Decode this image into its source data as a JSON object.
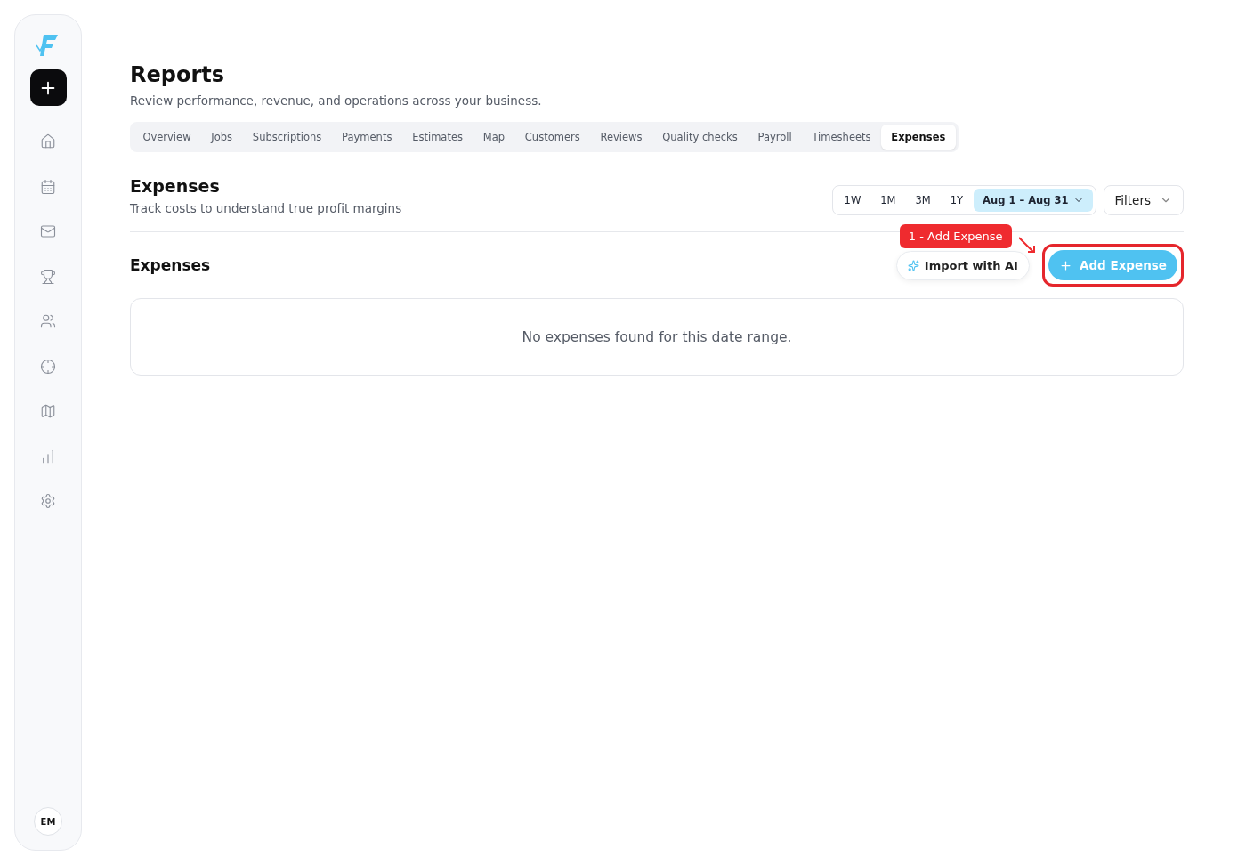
{
  "sidebar": {
    "avatar": "EM",
    "items": [
      {
        "kind": "home",
        "selected": false
      },
      {
        "kind": "calendar",
        "selected": false
      },
      {
        "kind": "mail",
        "selected": false
      },
      {
        "kind": "trophy",
        "selected": false
      },
      {
        "kind": "users",
        "selected": false
      },
      {
        "kind": "target",
        "selected": false
      },
      {
        "kind": "map",
        "selected": false
      },
      {
        "kind": "chart",
        "selected": false
      },
      {
        "kind": "settings",
        "selected": false
      }
    ]
  },
  "page": {
    "title": "Reports",
    "subtitle": "Review performance, revenue, and operations across your business."
  },
  "tabs": [
    {
      "label": "Overview",
      "selected": false
    },
    {
      "label": "Jobs",
      "selected": false
    },
    {
      "label": "Subscriptions",
      "selected": false
    },
    {
      "label": "Payments",
      "selected": false
    },
    {
      "label": "Estimates",
      "selected": false
    },
    {
      "label": "Map",
      "selected": false
    },
    {
      "label": "Customers",
      "selected": false
    },
    {
      "label": "Reviews",
      "selected": false
    },
    {
      "label": "Quality checks",
      "selected": false
    },
    {
      "label": "Payroll",
      "selected": false
    },
    {
      "label": "Timesheets",
      "selected": false
    },
    {
      "label": "Expenses",
      "selected": true
    }
  ],
  "section": {
    "title": "Expenses",
    "subtitle": "Track costs to understand true profit margins"
  },
  "ranges": [
    {
      "label": "1W",
      "selected": false
    },
    {
      "label": "1M",
      "selected": false
    },
    {
      "label": "3M",
      "selected": false
    },
    {
      "label": "1Y",
      "selected": false
    },
    {
      "label": "Aug 1 – Aug 31",
      "selected": true
    }
  ],
  "filters": "Filters",
  "list": {
    "title": "Expenses",
    "import_button": "Import with AI",
    "add_button": "Add Expense",
    "empty": "No expenses found for this date range."
  },
  "callout": {
    "label": "1 - Add Expense"
  }
}
